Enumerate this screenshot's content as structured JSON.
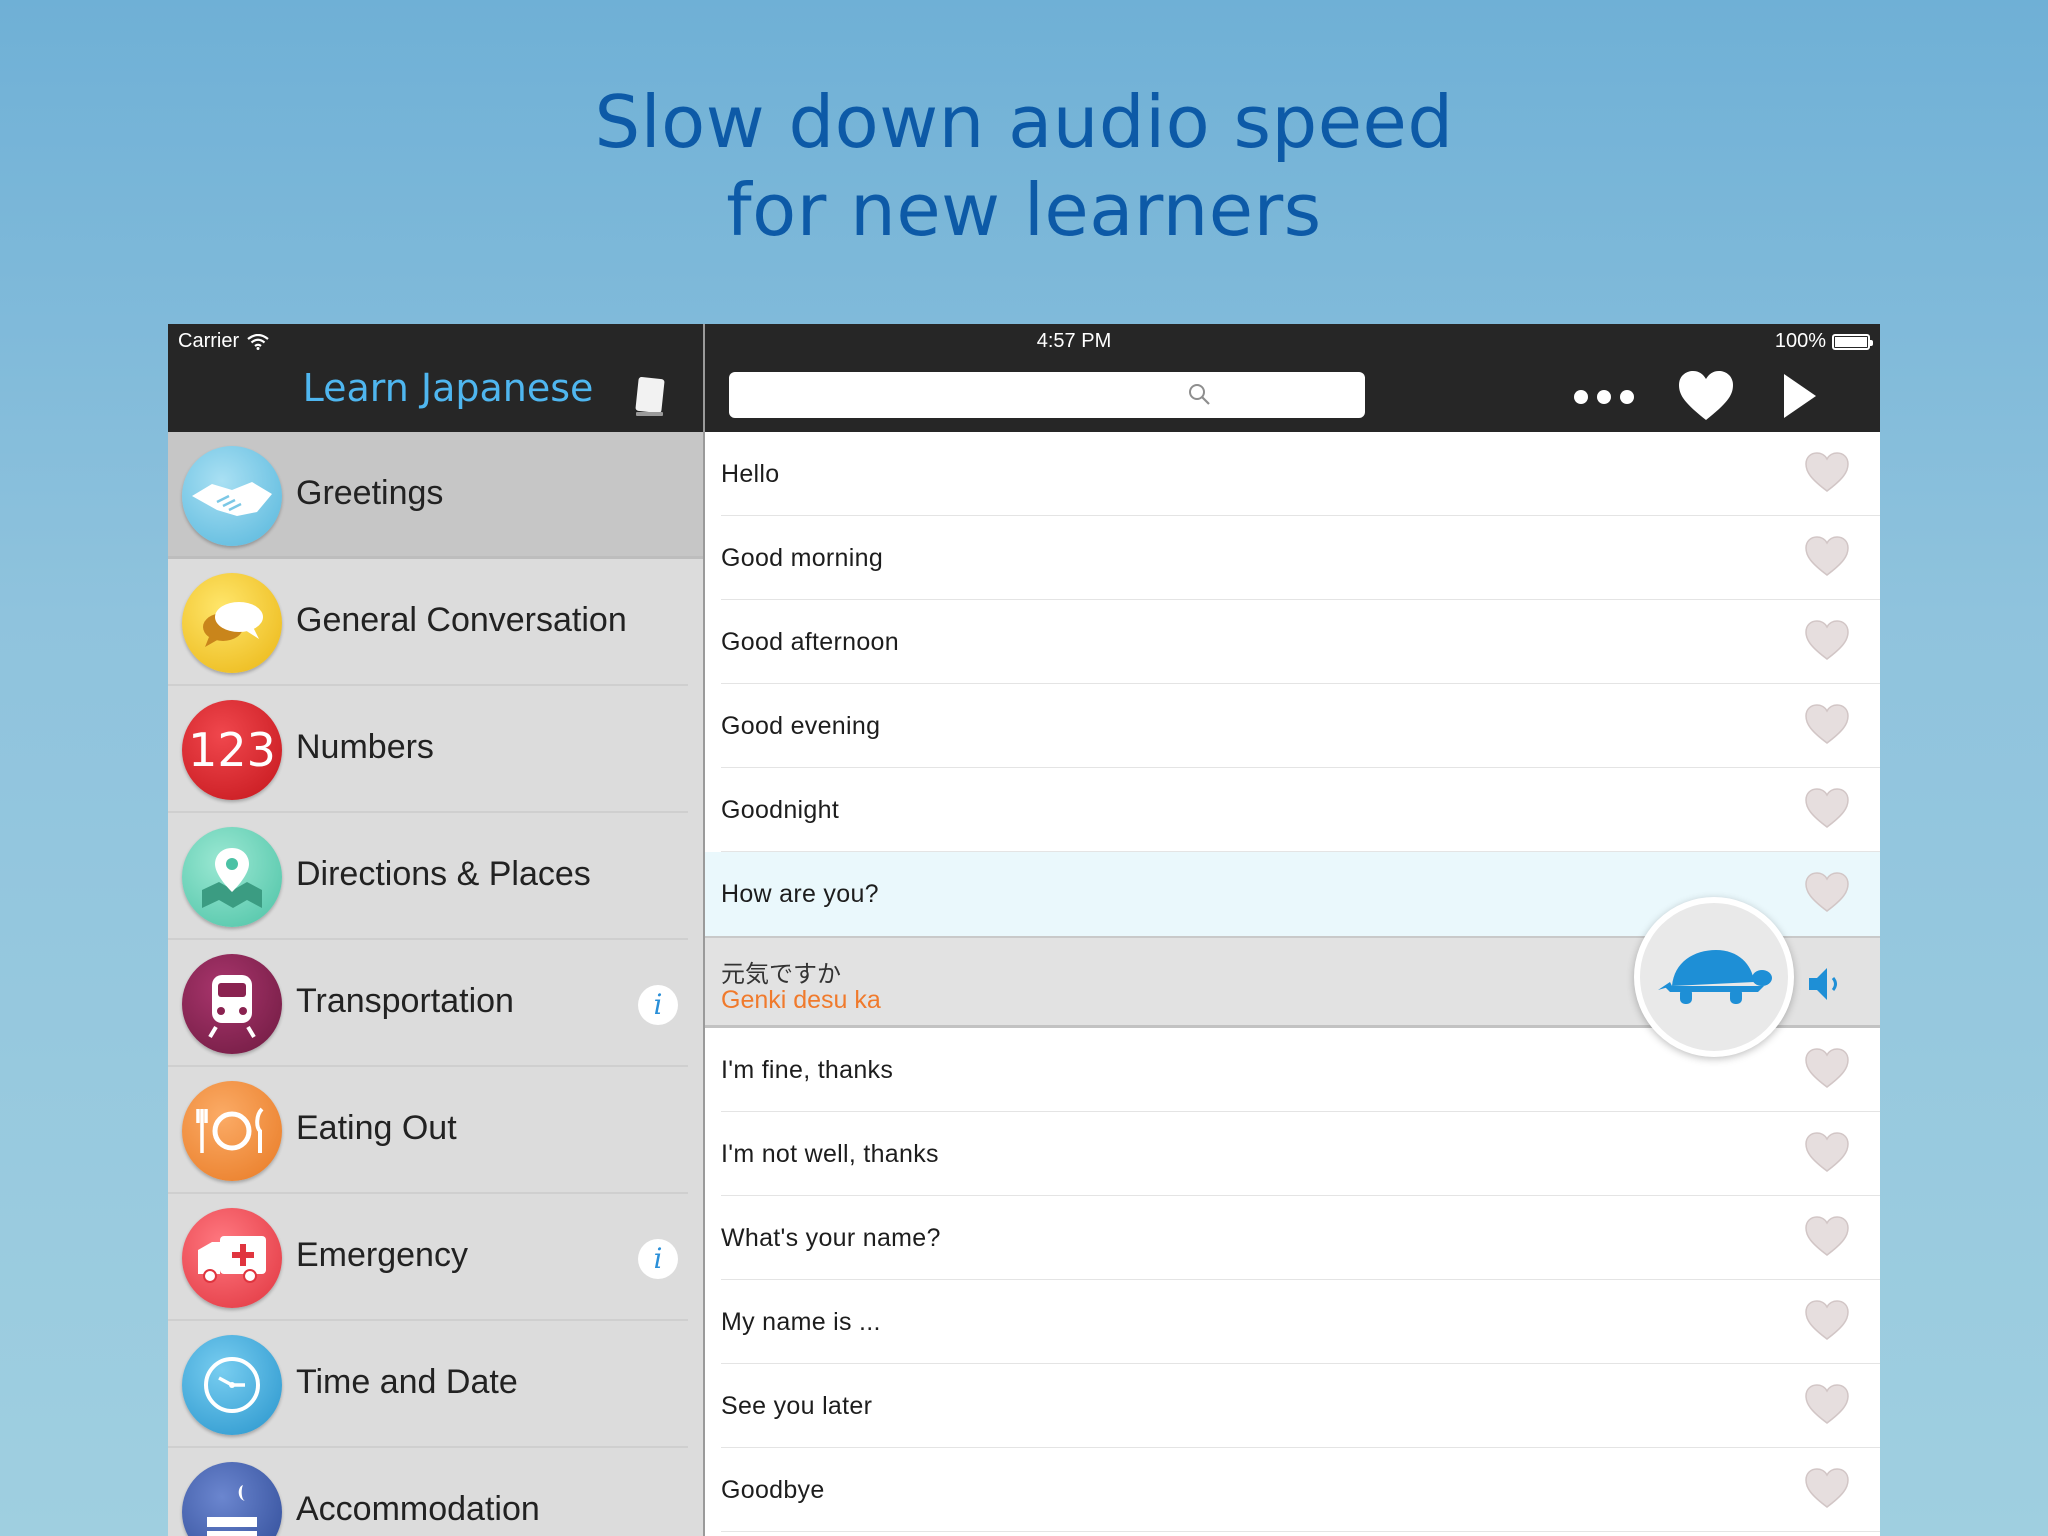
{
  "headline": {
    "line1": "Slow down audio speed",
    "line2": "for new learners"
  },
  "status_bar": {
    "carrier": "Carrier",
    "time": "4:57 PM",
    "battery": "100%"
  },
  "nav": {
    "title": "Learn Japanese",
    "search_placeholder": ""
  },
  "categories": [
    {
      "label": "Greetings",
      "icon": "handshake-icon",
      "color": "#7cc8e6",
      "selected": true,
      "info": false
    },
    {
      "label": "General Conversation",
      "icon": "speech-bubbles-icon",
      "color": "#f2c51e",
      "selected": false,
      "info": false
    },
    {
      "label": "Numbers",
      "icon": "numbers-icon",
      "icon_text": "123",
      "color": "#d9252c",
      "selected": false,
      "info": false
    },
    {
      "label": "Directions & Places",
      "icon": "map-pin-icon",
      "color": "#6fd3bb",
      "selected": false,
      "info": false
    },
    {
      "label": "Transportation",
      "icon": "train-icon",
      "color": "#8a2250",
      "selected": false,
      "info": true
    },
    {
      "label": "Eating Out",
      "icon": "plate-cutlery-icon",
      "color": "#f08a3a",
      "selected": false,
      "info": false
    },
    {
      "label": "Emergency",
      "icon": "ambulance-icon",
      "color": "#ee4a55",
      "selected": false,
      "info": true
    },
    {
      "label": "Time and Date",
      "icon": "clock-icon",
      "color": "#3aa7d9",
      "selected": false,
      "info": false
    },
    {
      "label": "Accommodation",
      "icon": "bed-icon",
      "color": "#3c5aa8",
      "selected": false,
      "info": false
    }
  ],
  "phrases_before": [
    "Hello",
    "Good morning",
    "Good afternoon",
    "Good evening",
    "Goodnight",
    "How are you?"
  ],
  "expanded": {
    "japanese": "元気ですか",
    "romaji": "Genki desu ka"
  },
  "phrases_after": [
    "I'm fine, thanks",
    "I'm not well, thanks",
    "What's your name?",
    "My name is ...",
    "See you later",
    "Goodbye"
  ],
  "colors": {
    "headline": "#0d5aa7",
    "title": "#4fb6ef",
    "romaji": "#f07a2c",
    "turtle": "#1e8fd6"
  }
}
